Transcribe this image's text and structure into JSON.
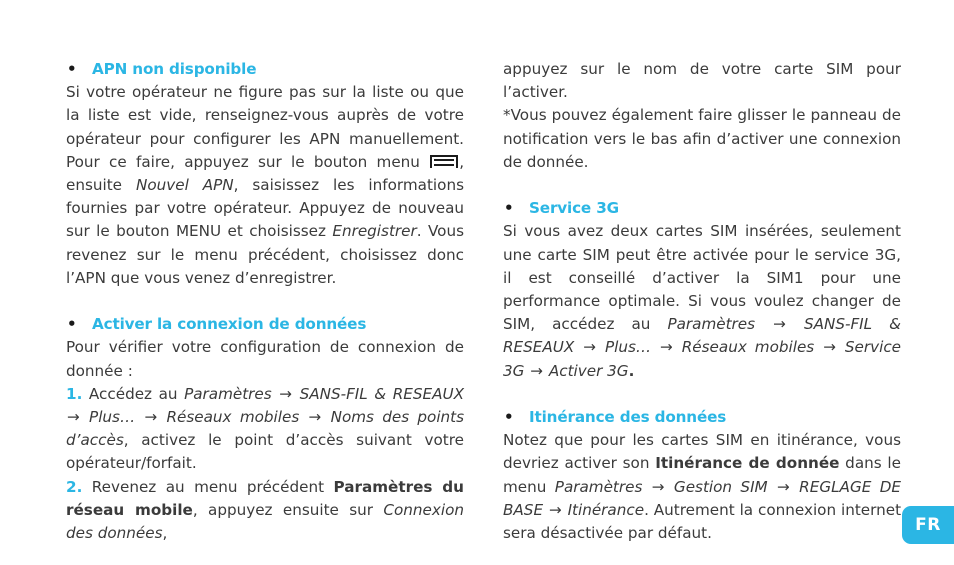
{
  "document": {
    "language_badge": "FR",
    "accent_color": "#2bb6e4",
    "body_color": "#3b3b3b",
    "bullet_glyph": "•",
    "arrow_glyph": "→",
    "menu_icon_name": "menu-key-icon"
  },
  "left_column": {
    "section1": {
      "heading": "APN non disponible",
      "para_part1": "Si votre opérateur ne figure pas sur la liste ou que la liste est vide, renseignez-vous auprès de votre opérateur pour configurer les APN manuellement. Pour ce faire, appuyez sur le bouton menu",
      "para_part2": ", ensuite ",
      "italic1": "Nouvel APN",
      "para_part3": ", saisissez les informations fournies par votre opérateur. Appuyez de nouveau sur le bouton MENU et choisissez ",
      "italic2": "Enregistrer",
      "para_part4": ". Vous revenez sur le menu précédent, choisissez donc l’APN que vous venez d’enregistrer."
    },
    "section2": {
      "heading": "Activer la connexion de données",
      "intro": "Pour vérifier votre configuration de connexion de donnée :",
      "item1": {
        "number": "1.",
        "text_before": " Accédez au ",
        "path": [
          "Paramètres",
          "SANS-FIL & RESEAUX",
          "Plus…",
          "Réseaux mobiles",
          "Noms des points d’accès"
        ],
        "text_after": ", activez le point d’accès suivant votre opérateur/forfait."
      },
      "item2": {
        "number": "2.",
        "text_before": " Revenez au menu précédent ",
        "bold": "Paramètres du réseau mobile",
        "text_mid": ", appuyez ensuite sur ",
        "italic": "Connexion des données",
        "text_after": ","
      }
    }
  },
  "right_column": {
    "continuation": {
      "line1": "appuyez sur le nom de votre carte SIM pour l’activer.",
      "line2": "*Vous pouvez également faire glisser le panneau de notification vers le bas afin d’activer une connexion de donnée."
    },
    "section3": {
      "heading": "Service 3G",
      "para": "Si vous avez deux cartes SIM insérées, seulement une carte SIM peut être activée pour le service 3G, il est conseillé d’activer la SIM1 pour une performance optimale. Si vous voulez changer de SIM, accédez au ",
      "path": [
        "Paramètres",
        "SANS-FIL & RESEAUX",
        "Plus…",
        "Réseaux mobiles",
        "Service 3G",
        "Activer 3G"
      ],
      "path_end": "."
    },
    "section4": {
      "heading": "Itinérance des données",
      "text_before": "Notez que pour les cartes SIM en itinérance, vous devriez activer son ",
      "bold": "Itinérance de donnée",
      "text_mid": " dans le menu ",
      "path": [
        "Paramètres",
        "Gestion SIM",
        "REGLAGE DE BASE",
        "Itinérance"
      ],
      "text_after": ". Autrement la connexion internet sera désactivée par défaut."
    }
  }
}
